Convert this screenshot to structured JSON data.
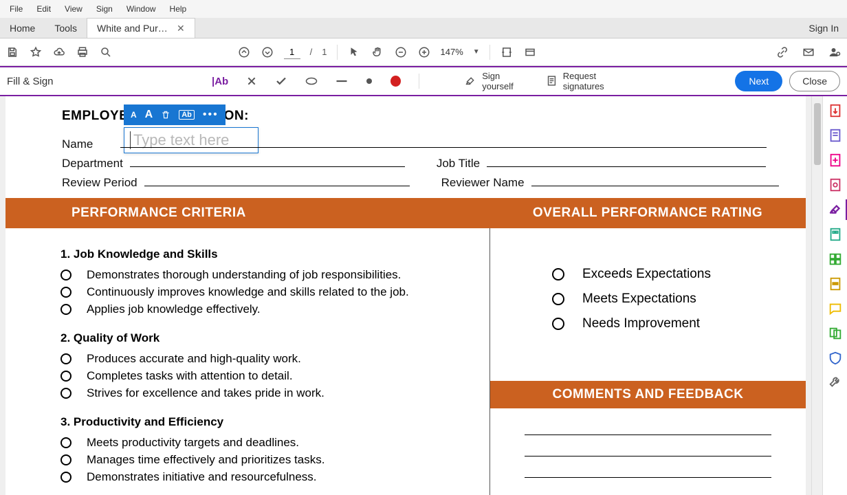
{
  "menu": {
    "items": [
      "File",
      "Edit",
      "View",
      "Sign",
      "Window",
      "Help"
    ]
  },
  "tabs": {
    "home": "Home",
    "tools": "Tools",
    "doc_label": "White and Purple Si..."
  },
  "header_right": {
    "signin": "Sign In"
  },
  "toolbar": {
    "page_current": "1",
    "page_separator": "/",
    "page_total": "1",
    "zoom": "147%"
  },
  "fillsign": {
    "title": "Fill & Sign",
    "text_icon": "|Ab",
    "sign_yourself": "Sign yourself",
    "request_signatures": "Request signatures",
    "next": "Next",
    "close": "Close"
  },
  "text_entry": {
    "placeholder": "Type text here"
  },
  "doc": {
    "heading": "EMPLOYEE INFORMATION:",
    "heading_visible_left": "EMPLOYE",
    "heading_visible_right": "ON:",
    "fields": {
      "name": "Name",
      "department": "Department",
      "job_title": "Job Title",
      "review_period": "Review Period",
      "reviewer_name": "Reviewer Name"
    },
    "bar_left": "PERFORMANCE CRITERIA",
    "bar_right": "OVERALL PERFORMANCE RATING",
    "criteria": [
      {
        "title": "1. Job Knowledge and Skills",
        "items": [
          "Demonstrates thorough understanding of job responsibilities.",
          "Continuously improves knowledge and skills related to the job.",
          "Applies job knowledge effectively."
        ]
      },
      {
        "title": "2. Quality of Work",
        "items": [
          "Produces accurate and high-quality work.",
          "Completes tasks with attention to detail.",
          "Strives for excellence and takes pride in work."
        ]
      },
      {
        "title": "3. Productivity and Efficiency",
        "items": [
          "Meets productivity targets and deadlines.",
          "Manages time effectively and prioritizes tasks.",
          "Demonstrates initiative and resourcefulness."
        ]
      }
    ],
    "ratings": [
      "Exceeds Expectations",
      "Meets Expectations",
      "Needs Improvement"
    ],
    "comments_header": "COMMENTS AND FEEDBACK"
  }
}
